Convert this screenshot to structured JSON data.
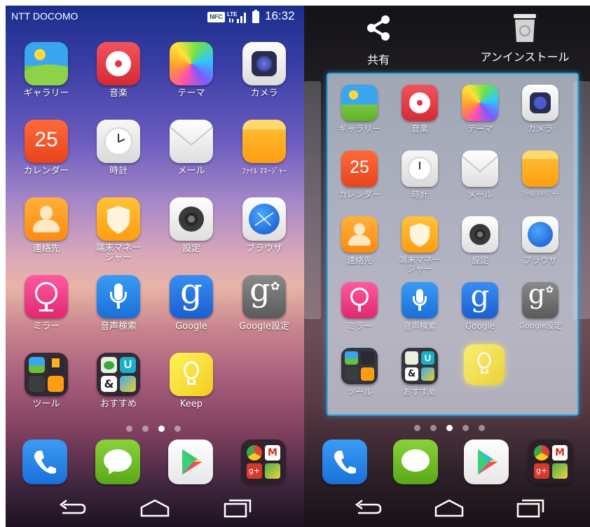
{
  "status_bar": {
    "carrier": "NTT DOCOMO",
    "nfc_label": "NFC",
    "network": "LTE",
    "time": "16:32"
  },
  "home": {
    "rows": [
      [
        {
          "label": "ギャラリー",
          "icon": "gallery-icon"
        },
        {
          "label": "音楽",
          "icon": "music-icon"
        },
        {
          "label": "テーマ",
          "icon": "theme-icon"
        },
        {
          "label": "カメラ",
          "icon": "camera-icon"
        }
      ],
      [
        {
          "label": "カレンダー",
          "icon": "calendar-icon",
          "badge": "25"
        },
        {
          "label": "時計",
          "icon": "clock-icon"
        },
        {
          "label": "メール",
          "icon": "mail-icon"
        },
        {
          "label": "ﾌｧｲﾙ ﾏﾈｰｼﾞｬｰ",
          "icon": "file-manager-icon"
        }
      ],
      [
        {
          "label": "連絡先",
          "icon": "contacts-icon"
        },
        {
          "label": "端末マネー",
          "label2": "ジャー",
          "icon": "phone-manager-icon"
        },
        {
          "label": "設定",
          "icon": "settings-icon"
        },
        {
          "label": "ブラウザ",
          "icon": "browser-icon"
        }
      ],
      [
        {
          "label": "ミラー",
          "icon": "mirror-icon"
        },
        {
          "label": "音声検索",
          "icon": "voice-search-icon"
        },
        {
          "label": "Google",
          "icon": "google-icon",
          "glyph": "g"
        },
        {
          "label": "Google設定",
          "icon": "google-settings-icon",
          "glyph": "g"
        }
      ],
      [
        {
          "label": "ツール",
          "icon": "tools-folder-icon"
        },
        {
          "label": "おすすめ",
          "icon": "recommended-folder-icon",
          "glyph": "U"
        },
        {
          "label": "Keep",
          "icon": "keep-icon"
        }
      ]
    ],
    "page_indicator": {
      "count": 4,
      "active": 3
    }
  },
  "edit": {
    "share_label": "共有",
    "uninstall_label": "アンインストール",
    "page_indicator": {
      "count": 5,
      "active": 3
    }
  },
  "dock": [
    {
      "icon": "phone-icon"
    },
    {
      "icon": "messaging-icon"
    },
    {
      "icon": "play-store-icon"
    },
    {
      "icon": "google-apps-folder-icon"
    }
  ],
  "nav": {
    "back": "back-icon",
    "home": "home-icon",
    "recents": "recents-icon"
  }
}
